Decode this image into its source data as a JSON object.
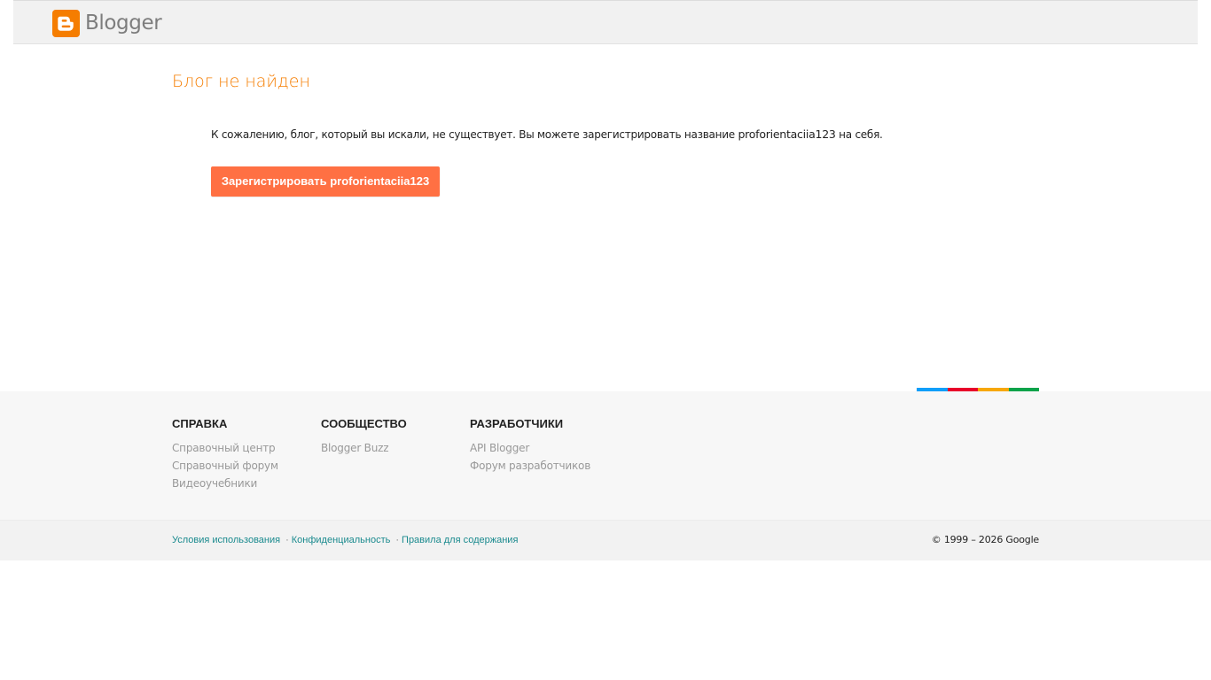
{
  "header": {
    "logo_text": "Blogger",
    "logo_icon": "blogger-icon",
    "brand_color": "#f57d00"
  },
  "main": {
    "title": "Блог не найден",
    "message_before": "К сожалению, блог, который вы искали, не существует. Вы можете зарегистрировать название ",
    "blog_name": "proforientaciia123",
    "message_after": " на себя.",
    "register_button_label": "Зарегистрировать proforientaciia123",
    "button_color": "#ff7043"
  },
  "google_bar_colors": [
    "#0f9ef9",
    "#e8002a",
    "#f7a707",
    "#0aa34a"
  ],
  "footer": {
    "columns": [
      {
        "heading": "СПРАВКА",
        "links": [
          "Справочный центр",
          "Справочный форум",
          "Видеоучебники"
        ]
      },
      {
        "heading": "СООБЩЕСТВО",
        "links": [
          "Blogger Buzz"
        ]
      },
      {
        "heading": "РАЗРАБОТЧИКИ",
        "links": [
          "API Blogger",
          "Форум разработчиков"
        ]
      }
    ]
  },
  "legal": {
    "links": [
      "Условия использования",
      "Конфиденциальность",
      "Правила для содержания"
    ],
    "separator": "·",
    "copyright": "© 1999 – 2026 Google"
  }
}
